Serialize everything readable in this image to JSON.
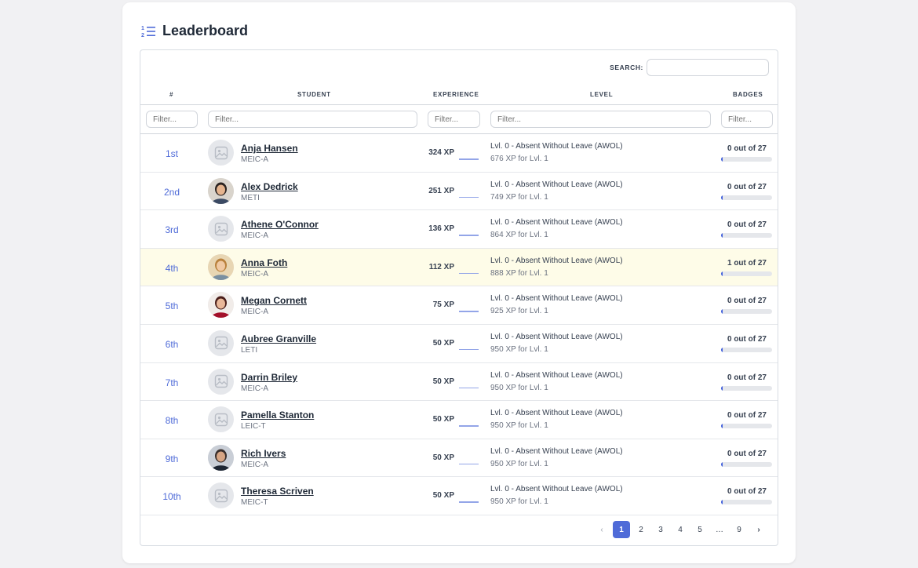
{
  "page": {
    "title": "Leaderboard"
  },
  "search": {
    "label": "SEARCH:",
    "value": ""
  },
  "columns": {
    "rank": "#",
    "student": "STUDENT",
    "experience": "EXPERIENCE",
    "level": "LEVEL",
    "badges": "BADGES"
  },
  "filters": {
    "placeholder": "Filter..."
  },
  "icons": {
    "title": "numbered-list-icon",
    "placeholder_avatar": "image-placeholder-icon",
    "prev": "chevron-left-icon",
    "next": "chevron-right-icon"
  },
  "colors": {
    "accent": "#4f6bd8",
    "highlight_row": "#fefce8"
  },
  "rows": [
    {
      "rank": "1st",
      "name": "Anja Hansen",
      "major": "MEIC-A",
      "xp": "324 XP",
      "level": "Lvl. 0 - Absent Without Leave (AWOL)",
      "next": "676 XP for Lvl. 1",
      "badges": "0 out of 27",
      "avatar": "placeholder",
      "highlight": false
    },
    {
      "rank": "2nd",
      "name": "Alex Dedrick",
      "major": "METI",
      "xp": "251 XP",
      "level": "Lvl. 0 - Absent Without Leave (AWOL)",
      "next": "749 XP for Lvl. 1",
      "badges": "0 out of 27",
      "avatar": "photo",
      "highlight": false
    },
    {
      "rank": "3rd",
      "name": "Athene O'Connor",
      "major": "MEIC-A",
      "xp": "136 XP",
      "level": "Lvl. 0 - Absent Without Leave (AWOL)",
      "next": "864 XP for Lvl. 1",
      "badges": "0 out of 27",
      "avatar": "placeholder",
      "highlight": false
    },
    {
      "rank": "4th",
      "name": "Anna Foth",
      "major": "MEIC-A",
      "xp": "112 XP",
      "level": "Lvl. 0 - Absent Without Leave (AWOL)",
      "next": "888 XP for Lvl. 1",
      "badges": "1 out of 27",
      "avatar": "photo",
      "highlight": true
    },
    {
      "rank": "5th",
      "name": "Megan Cornett",
      "major": "MEIC-A",
      "xp": "75 XP",
      "level": "Lvl. 0 - Absent Without Leave (AWOL)",
      "next": "925 XP for Lvl. 1",
      "badges": "0 out of 27",
      "avatar": "photo",
      "highlight": false
    },
    {
      "rank": "6th",
      "name": "Aubree Granville",
      "major": "LETI",
      "xp": "50 XP",
      "level": "Lvl. 0 - Absent Without Leave (AWOL)",
      "next": "950 XP for Lvl. 1",
      "badges": "0 out of 27",
      "avatar": "placeholder",
      "highlight": false
    },
    {
      "rank": "7th",
      "name": "Darrin Briley",
      "major": "MEIC-A",
      "xp": "50 XP",
      "level": "Lvl. 0 - Absent Without Leave (AWOL)",
      "next": "950 XP for Lvl. 1",
      "badges": "0 out of 27",
      "avatar": "placeholder",
      "highlight": false
    },
    {
      "rank": "8th",
      "name": "Pamella Stanton",
      "major": "LEIC-T",
      "xp": "50 XP",
      "level": "Lvl. 0 - Absent Without Leave (AWOL)",
      "next": "950 XP for Lvl. 1",
      "badges": "0 out of 27",
      "avatar": "placeholder",
      "highlight": false
    },
    {
      "rank": "9th",
      "name": "Rich Ivers",
      "major": "MEIC-A",
      "xp": "50 XP",
      "level": "Lvl. 0 - Absent Without Leave (AWOL)",
      "next": "950 XP for Lvl. 1",
      "badges": "0 out of 27",
      "avatar": "photo",
      "highlight": false
    },
    {
      "rank": "10th",
      "name": "Theresa Scriven",
      "major": "MEIC-T",
      "xp": "50 XP",
      "level": "Lvl. 0 - Absent Without Leave (AWOL)",
      "next": "950 XP for Lvl. 1",
      "badges": "0 out of 27",
      "avatar": "placeholder",
      "highlight": false
    }
  ],
  "pagination": {
    "prev": "‹",
    "pages": [
      "1",
      "2",
      "3",
      "4",
      "5",
      "…",
      "9"
    ],
    "active": "1",
    "next": "›"
  }
}
